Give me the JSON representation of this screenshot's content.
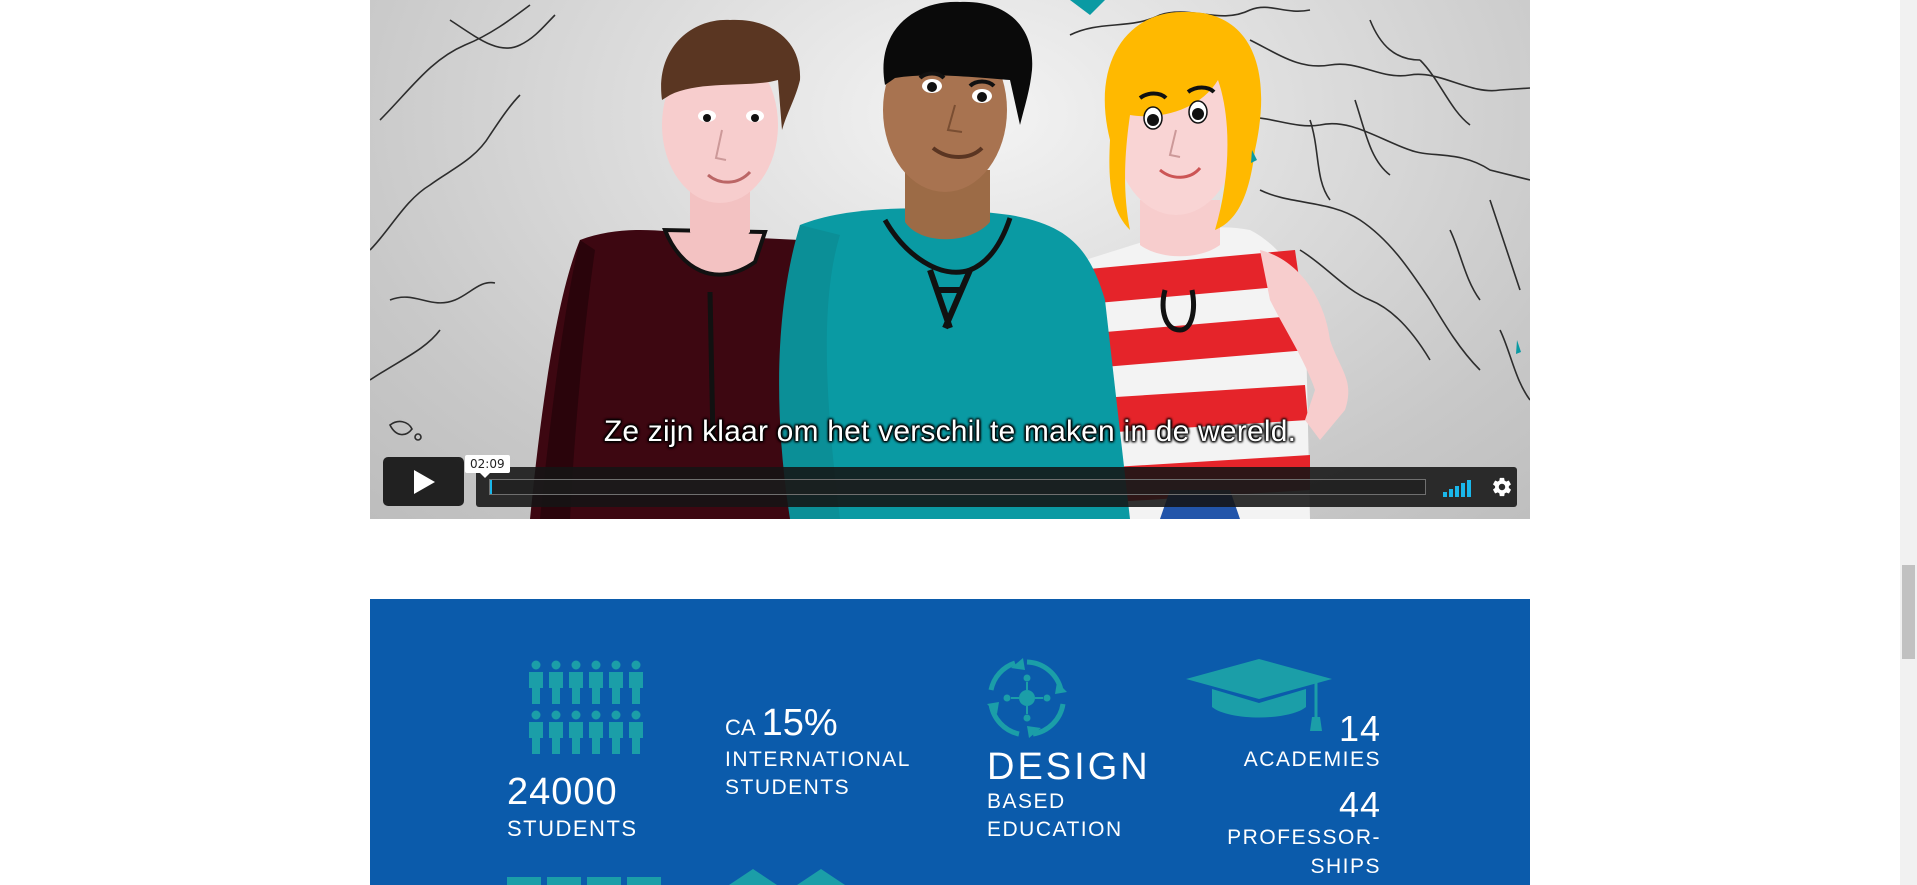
{
  "video": {
    "subtitle": "Ze zijn klaar om het verschil te maken in de wereld.",
    "time_tooltip": "02:09",
    "progress_percent": 0.2,
    "accent_color": "#1ab7ea",
    "icons": {
      "play": "play-icon",
      "volume": "volume-icon",
      "settings": "gear-icon"
    }
  },
  "infographic": {
    "background_color": "#0b5bab",
    "accent_color": "#1b9ea8",
    "students": {
      "number": "24000",
      "label": "STUDENTS"
    },
    "international": {
      "prefix": "CA",
      "percent": "15%",
      "line1": "INTERNATIONAL",
      "line2": "STUDENTS"
    },
    "design": {
      "title": "DESIGN",
      "line1": "BASED",
      "line2": "EDUCATION"
    },
    "academies": {
      "number": "14",
      "label": "ACADEMIES"
    },
    "professorships": {
      "number": "44",
      "line1": "PROFESSOR-",
      "line2": "SHIPS"
    },
    "icons": [
      "people-icon",
      "design-cycle-icon",
      "graduation-cap-icon"
    ]
  }
}
